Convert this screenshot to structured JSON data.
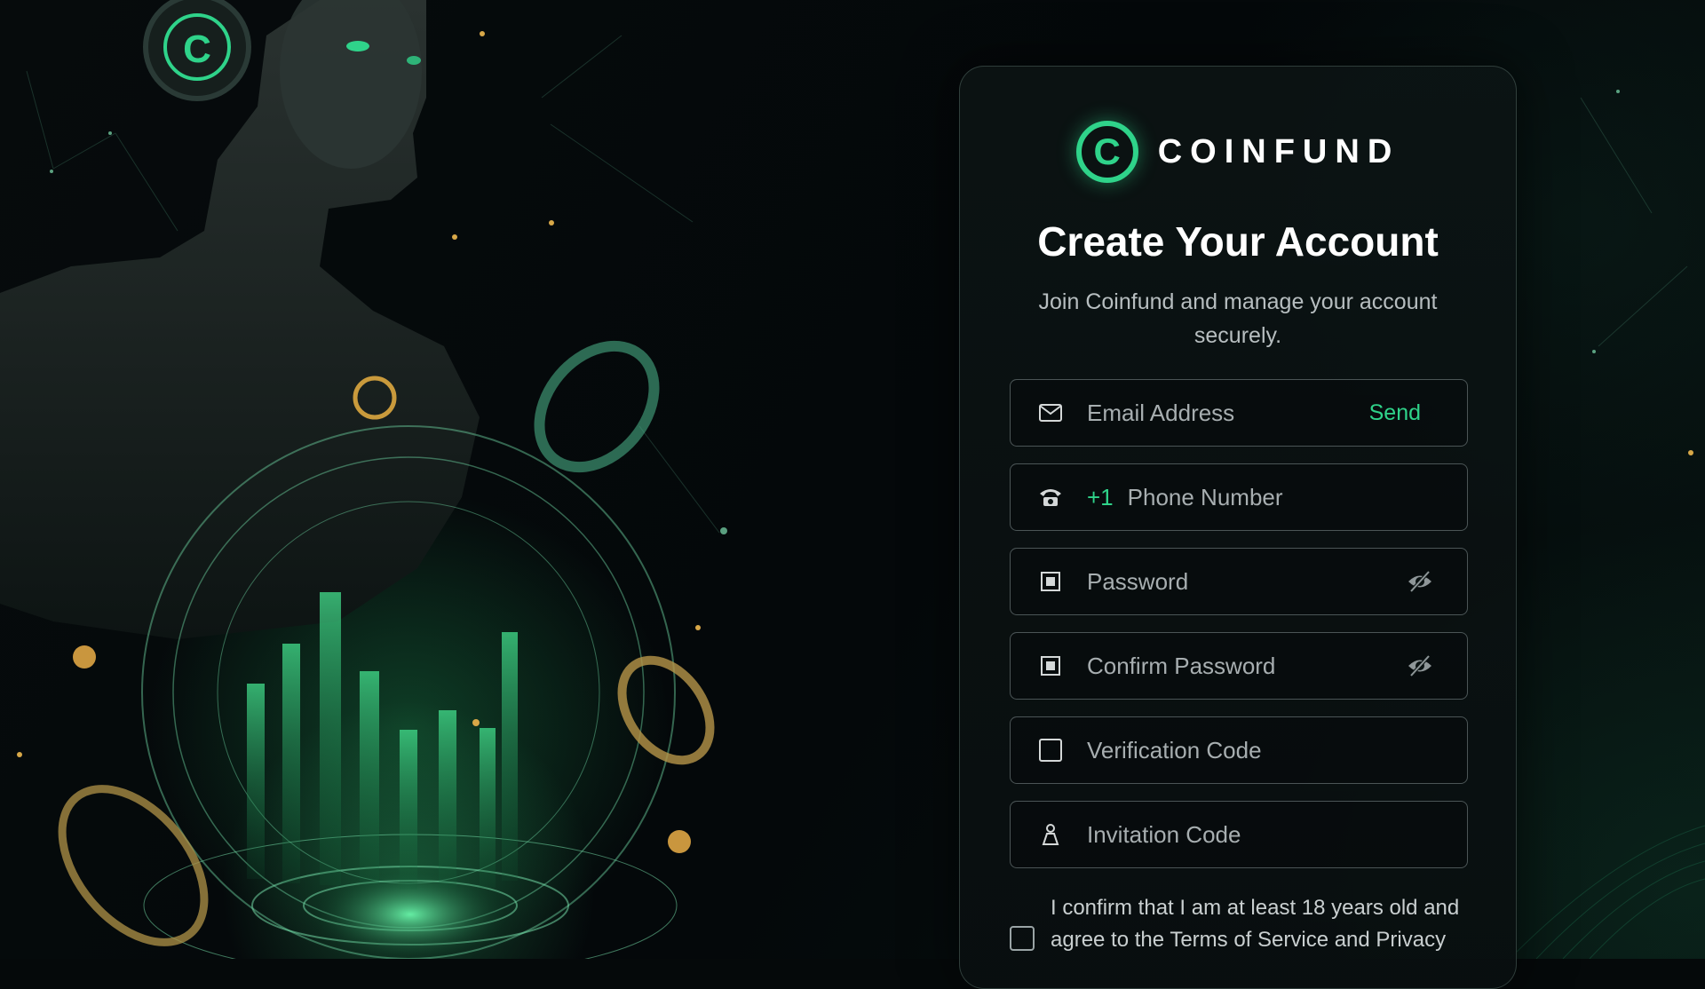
{
  "brand": {
    "logo_letter": "C",
    "name": "COINFUND",
    "accent_color": "#2fd38a"
  },
  "heading": {
    "title": "Create Your Account",
    "subtitle": "Join Coinfund and manage your account securely."
  },
  "form": {
    "email": {
      "placeholder": "Email Address",
      "icon": "envelope-icon",
      "action_label": "Send"
    },
    "phone": {
      "prefix": "+1",
      "placeholder": "Phone Number",
      "icon": "phone-icon"
    },
    "password": {
      "placeholder": "Password",
      "icon": "lock-icon",
      "toggle_icon": "eye-slash-icon"
    },
    "confirm_password": {
      "placeholder": "Confirm Password",
      "icon": "lock-icon",
      "toggle_icon": "eye-slash-icon"
    },
    "verification_code": {
      "placeholder": "Verification Code",
      "icon": "shield-icon"
    },
    "invitation_code": {
      "placeholder": "Invitation Code",
      "icon": "user-icon"
    },
    "agreement": {
      "text": "I confirm that I am at least 18 years old and agree to the Terms of Service and Privacy",
      "checked": false
    }
  }
}
